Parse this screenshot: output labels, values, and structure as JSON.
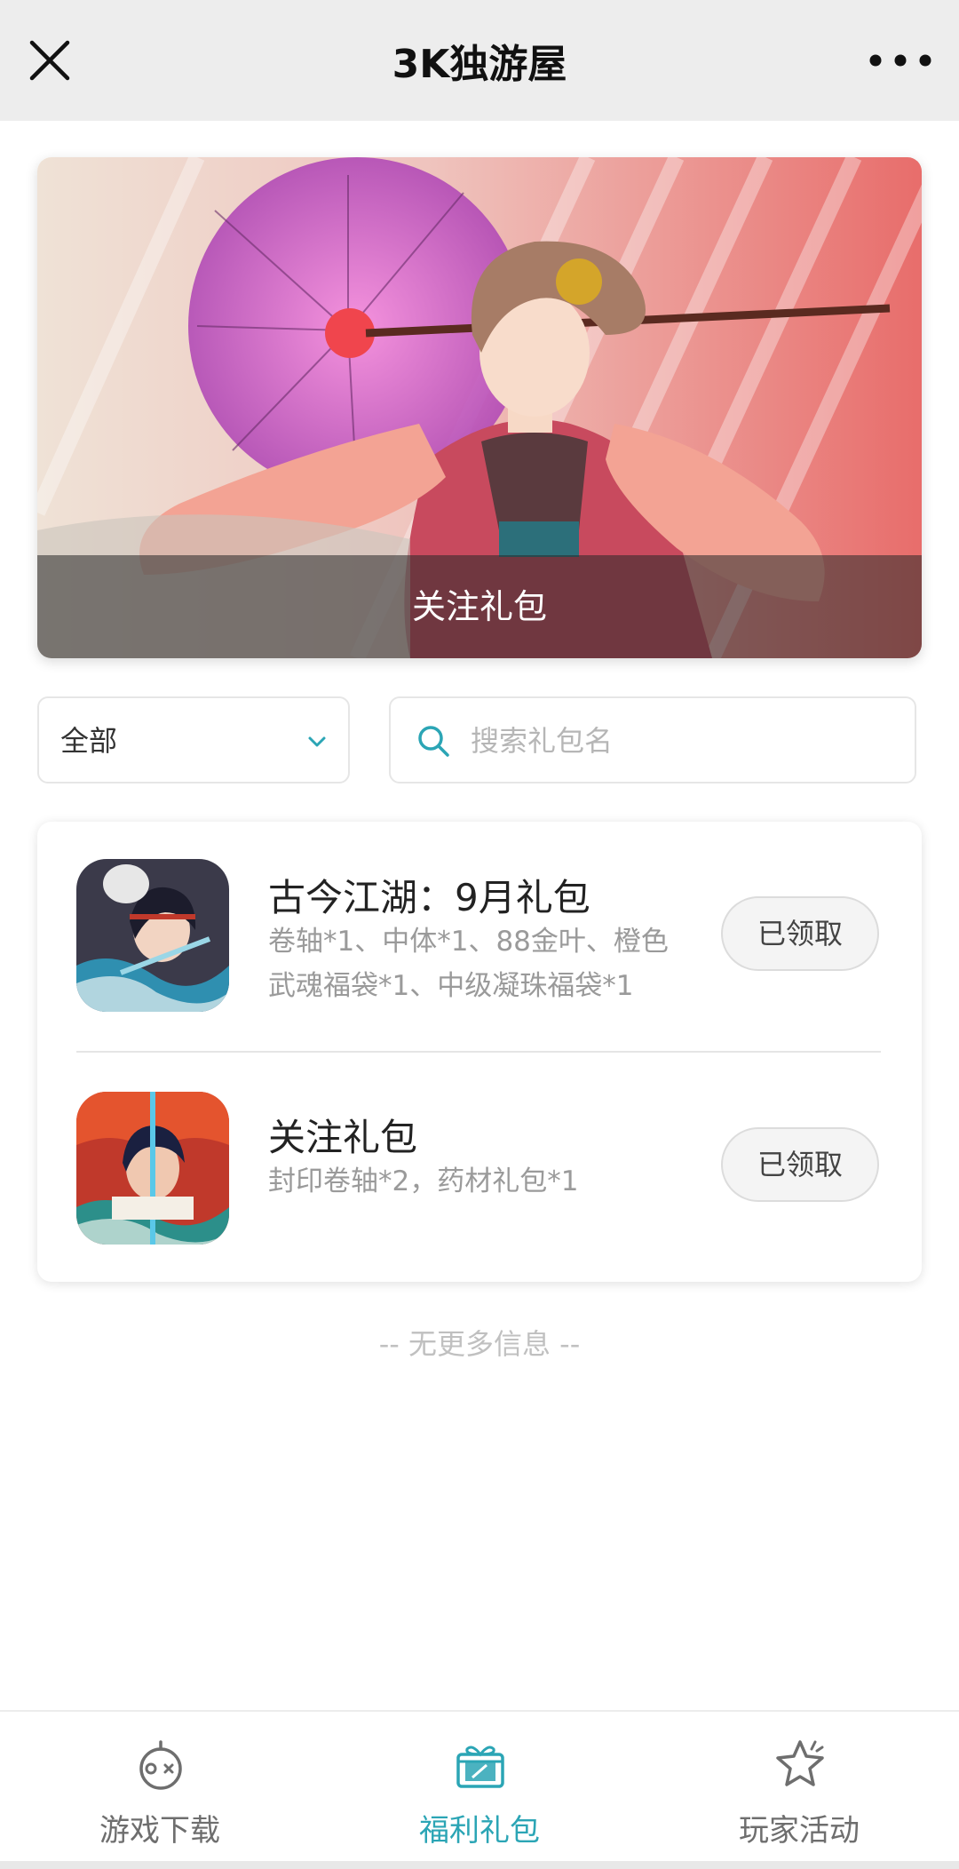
{
  "header": {
    "title": "3K独游屋",
    "close_icon": "close-icon",
    "more_icon": "more-icon"
  },
  "banner": {
    "caption": "关注礼包"
  },
  "filter": {
    "selected": "全部",
    "search_placeholder": "搜索礼包名"
  },
  "gifts": [
    {
      "name": "古今江湖：9月礼包",
      "desc_line1": "卷轴*1、中体*1、88金叶、橙色",
      "desc_line2": "武魂福袋*1、中级凝珠福袋*1",
      "button": "已领取"
    },
    {
      "name": "关注礼包",
      "desc_line1": "封印卷轴*2，药材礼包*1",
      "button": "已领取"
    }
  ],
  "footer_note": "-- 无更多信息 --",
  "tabs": [
    {
      "label": "游戏下载",
      "icon": "gamepad-icon"
    },
    {
      "label": "福利礼包",
      "icon": "gift-icon",
      "active": true
    },
    {
      "label": "玩家活动",
      "icon": "star-icon"
    }
  ],
  "colors": {
    "accent": "#2ba5b5",
    "header_bg": "#ededed"
  }
}
